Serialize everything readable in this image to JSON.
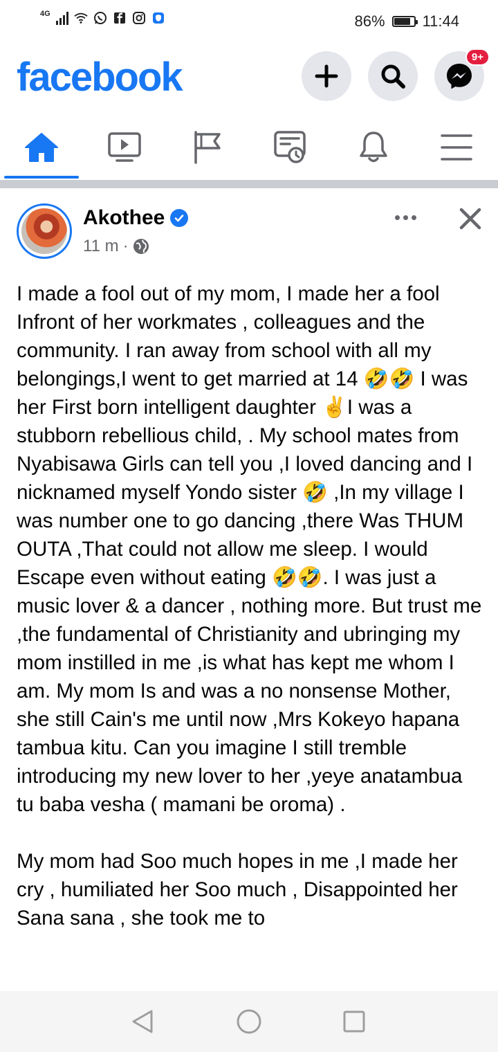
{
  "status_bar": {
    "network": "4G",
    "battery": "86%",
    "battery_level": 0.86,
    "time": "11:44",
    "notification_icons": [
      "wifi-icon",
      "whatsapp-icon",
      "facebook-icon",
      "instagram-icon",
      "shield-icon"
    ]
  },
  "header": {
    "logo": "facebook",
    "buttons": [
      "create-icon",
      "search-icon",
      "messenger-icon"
    ],
    "messenger_badge": "9+",
    "accent_color": "#1877f2",
    "badge_color": "#e41e3f"
  },
  "tabs": [
    {
      "name": "home",
      "icon": "home-icon",
      "active": true
    },
    {
      "name": "watch",
      "icon": "video-icon",
      "active": false
    },
    {
      "name": "pages",
      "icon": "flag-icon",
      "active": false
    },
    {
      "name": "news",
      "icon": "news-feed-icon",
      "active": false
    },
    {
      "name": "notifications",
      "icon": "bell-icon",
      "active": false
    },
    {
      "name": "menu",
      "icon": "hamburger-menu-icon",
      "active": false
    }
  ],
  "post": {
    "author": "Akothee",
    "verified": true,
    "time": "11 m",
    "separator": "·",
    "audience_icon": "globe-icon",
    "paragraph1": "I made a fool out of my mom, I made her a fool Infront of her workmates , colleagues  and the community.  I ran away from school with all my belongings,I went to get married at 14 🤣🤣 I was her First born intelligent daughter ✌️I was a stubborn rebellious child, . My school mates from Nyabisawa Girls can tell you ,I loved dancing and I nicknamed myself Yondo sister 🤣 ,In my village I was number one to go dancing ,there Was THUM OUTA ,That could not allow me sleep. I would Escape even without eating 🤣🤣. I was just a music lover & a dancer ,  nothing more. But trust me ,the fundamental of Christianity and ubringing my mom instilled in me ,is what has kept me whom I am. My mom Is and was a no nonsense Mother, she still Cain's me until now ,Mrs Kokeyo hapana tambua kitu. Can you imagine I still tremble introducing my new lover to her ,yeye anatambua tu baba vesha ( mamani be oroma) .",
    "paragraph2": "My mom had Soo much hopes in me ,I made her cry , humiliated her Soo much , Disappointed her Sana sana , she took me to"
  },
  "system_nav": [
    "back-icon",
    "home-circle-icon",
    "recents-icon"
  ]
}
